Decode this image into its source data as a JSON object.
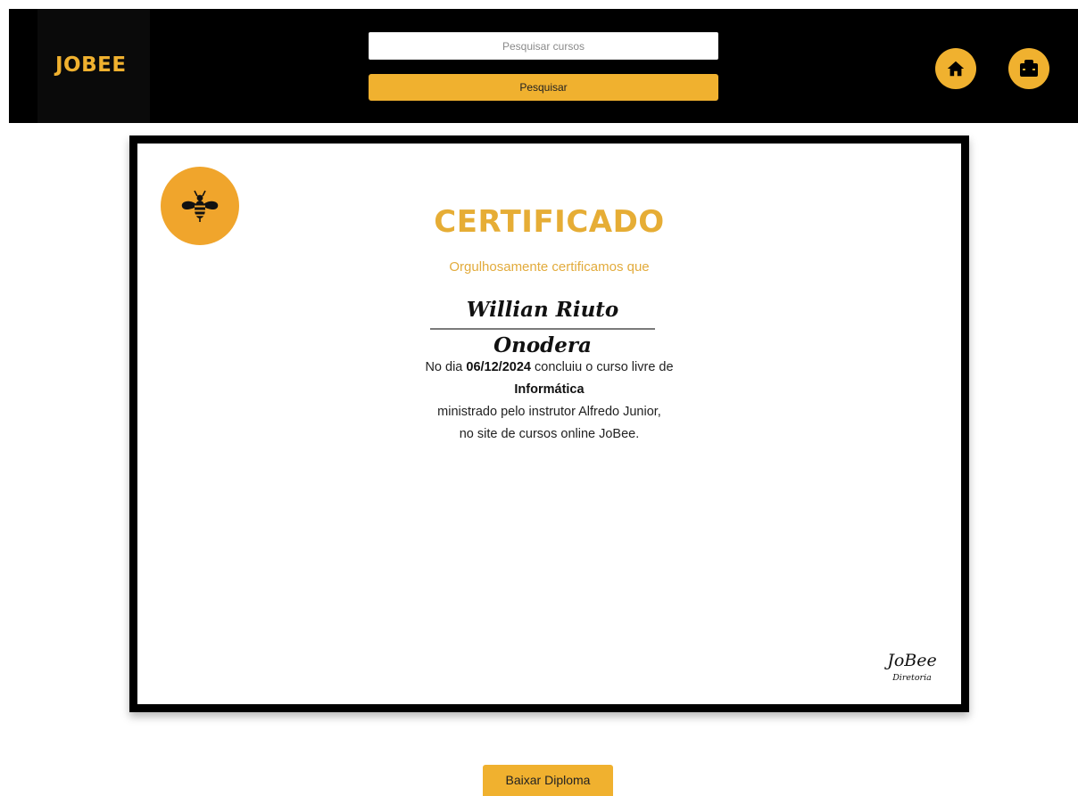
{
  "header": {
    "logo_text": "JOBEE",
    "search": {
      "placeholder": "Pesquisar cursos",
      "value": "",
      "button_label": "Pesquisar"
    },
    "nav_icons": [
      "home-icon",
      "briefcase-icon"
    ]
  },
  "certificate": {
    "badge_icon": "bee-icon",
    "title": "CERTIFICADO",
    "subtitle": "Orgulhosamente certificamos que",
    "recipient_name": "Willian Riuto Onodera",
    "body": {
      "line1_prefix": "No dia",
      "date": "06/12/2024",
      "line1_suffix": "concluiu o curso livre de",
      "course": "Informática",
      "line3": "ministrado pelo instrutor Alfredo Junior,",
      "line4": "no site de cursos online JoBee."
    },
    "signature": {
      "name": "JoBee",
      "role": "Diretoria"
    }
  },
  "download_button_label": "Baixar Diploma",
  "colors": {
    "accent": "#f0b12f",
    "header_bg": "#000000",
    "title": "#e6ad35"
  }
}
